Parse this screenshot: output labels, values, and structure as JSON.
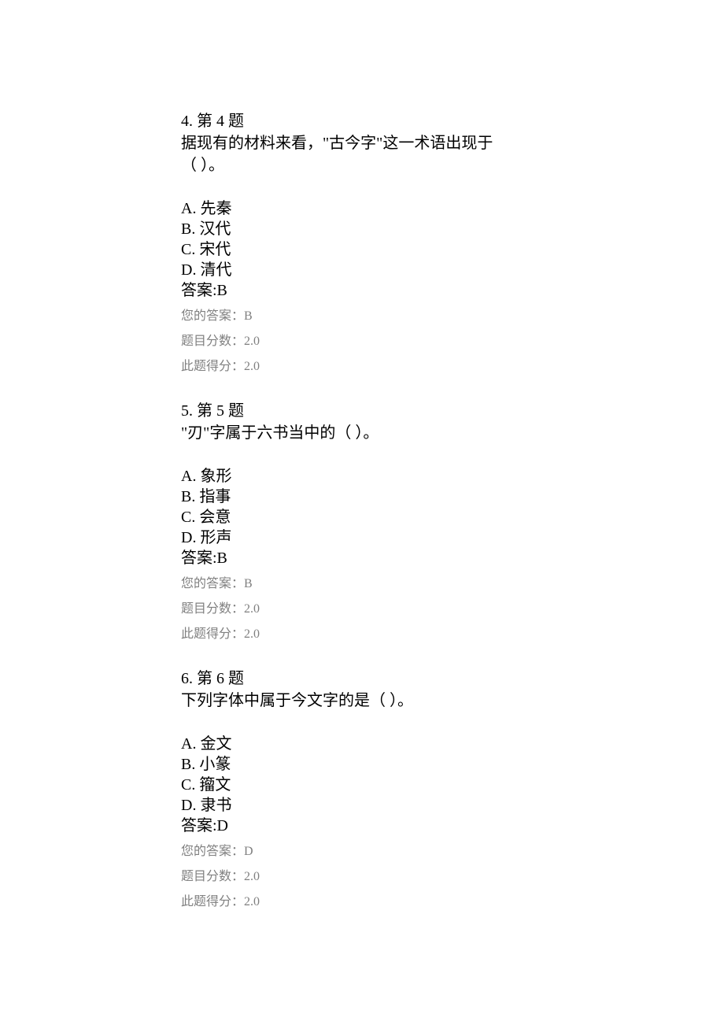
{
  "questions": [
    {
      "header": "4.  第 4 题",
      "text_line1": "据现有的材料来看，\"古今字\"这一术语出现于",
      "text_line2": "（        ）。",
      "options": {
        "a": "A. 先秦",
        "b": "B. 汉代",
        "c": "C. 宋代",
        "d": "D. 清代"
      },
      "answer_label": "答案:B",
      "your_answer": "您的答案：B",
      "score_label": "题目分数：2.0",
      "got_label": "此题得分：2.0"
    },
    {
      "header": "5.  第 5 题",
      "text_line1": "\"刃\"字属于六书当中的（        ）。",
      "text_line2": "",
      "options": {
        "a": "A. 象形",
        "b": "B. 指事",
        "c": "C. 会意",
        "d": "D. 形声"
      },
      "answer_label": "答案:B",
      "your_answer": "您的答案：B",
      "score_label": "题目分数：2.0",
      "got_label": "此题得分：2.0"
    },
    {
      "header": "6.  第 6 题",
      "text_line1": "下列字体中属于今文字的是（        ）。",
      "text_line2": "",
      "options": {
        "a": "A. 金文",
        "b": "B. 小篆",
        "c": "C. 籀文",
        "d": "D. 隶书"
      },
      "answer_label": "答案:D",
      "your_answer": "您的答案：D",
      "score_label": "题目分数：2.0",
      "got_label": "此题得分：2.0"
    }
  ]
}
